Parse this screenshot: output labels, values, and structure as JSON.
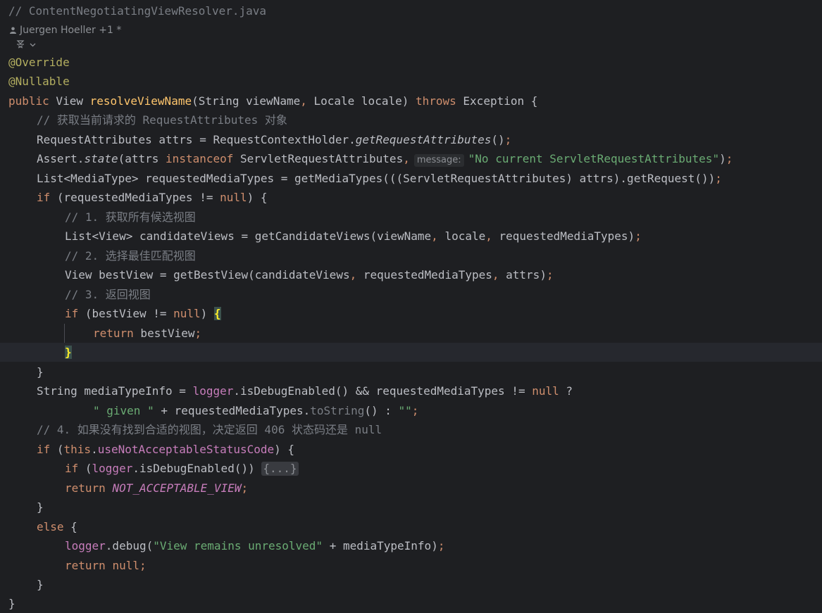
{
  "file_comment": "// ContentNegotiatingViewResolver.java",
  "author": {
    "icon": "user-icon",
    "text": "Juergen Hoeller +1 *"
  },
  "ai_actions": {
    "icon": "ai-assistant-icon",
    "chevron": "chevron-down-icon"
  },
  "code": {
    "l_override": "@Override",
    "l_nullable": "@Nullable",
    "l_sig": {
      "kw_public": "public",
      "type_view": " View ",
      "method": "resolveViewName",
      "params_a": "(String viewName",
      "comma": ",",
      "params_b": " Locale locale) ",
      "kw_throws": "throws",
      "tail": " Exception {"
    },
    "l_c1": "// 获取当前请求的 RequestAttributes 对象",
    "l_attrs": {
      "a": "RequestAttributes attrs = RequestContextHolder.",
      "m": "getRequestAttributes",
      "b": "()",
      "semi": ";"
    },
    "l_assert": {
      "a": "Assert.",
      "m": "state",
      "b": "(attrs ",
      "kw": "instanceof",
      "c": " ServletRequestAttributes",
      "comma": ",",
      "hint": "message:",
      "s": "\"No current ServletRequestAttributes\"",
      "d": ")",
      "semi": ";"
    },
    "l_mt": {
      "a": "List<MediaType> requestedMediaTypes = getMediaTypes(((ServletRequestAttributes) attrs).getRequest())",
      "semi": ";"
    },
    "l_if1": {
      "kw": "if",
      "a": " (requestedMediaTypes != ",
      "nul": "null",
      "b": ") {"
    },
    "l_c2": "// 1. 获取所有候选视图",
    "l_cand": {
      "a": "List<View> candidateViews = getCandidateViews(viewName",
      "c1": ",",
      "b": " locale",
      "c2": ",",
      "c": " requestedMediaTypes)",
      "semi": ";"
    },
    "l_c3": "// 2. 选择最佳匹配视图",
    "l_best": {
      "a": "View bestView = getBestView(candidateViews",
      "c1": ",",
      "b": " requestedMediaTypes",
      "c2": ",",
      "c": " attrs)",
      "semi": ";"
    },
    "l_c4": "// 3. 返回视图",
    "l_if2": {
      "kw": "if",
      "a": " (bestView != ",
      "nul": "null",
      "b": ") ",
      "brace": "{"
    },
    "l_ret1": {
      "kw": "return",
      "a": " bestView",
      "semi": ";"
    },
    "l_close_match": "}",
    "l_close1": "}",
    "l_info1": {
      "a": "String mediaTypeInfo = ",
      "f": "logger",
      "b": ".isDebugEnabled() && requestedMediaTypes != ",
      "nul": "null",
      "c": " ?"
    },
    "l_info2": {
      "s1": "\" given \"",
      "a": " + requestedMediaTypes.",
      "m": "toString",
      "b": "() : ",
      "s2": "\"\"",
      "semi": ";"
    },
    "l_c5": "// 4. 如果没有找到合适的视图，决定返回 406 状态码还是 null",
    "l_if3": {
      "kw": "if",
      "a": " (",
      "kw_this": "this",
      "dot": ".",
      "f": "useNotAcceptableStatusCode",
      "b": ") {"
    },
    "l_if4": {
      "kw": "if",
      "a": " (",
      "f": "logger",
      "b": ".isDebugEnabled()) ",
      "fold": "{...}"
    },
    "l_ret2": {
      "kw": "return",
      "a": " ",
      "const": "NOT_ACCEPTABLE_VIEW",
      "semi": ";"
    },
    "l_close2": "}",
    "l_else": {
      "kw": "else",
      "a": " {"
    },
    "l_debug": {
      "f": "logger",
      "a": ".debug(",
      "s": "\"View remains unresolved\"",
      "b": " + mediaTypeInfo)",
      "semi": ";"
    },
    "l_ret3": {
      "kw": "return",
      "a": " ",
      "nul": "null",
      "semi": ";"
    },
    "l_close3": "}",
    "l_close4": "}"
  },
  "colors": {
    "background": "#1e1f22",
    "comment": "#7a7e85",
    "annotation": "#b3ae60",
    "keyword": "#cf8e6d",
    "method_decl": "#ffc66d",
    "string": "#6aab73",
    "field": "#c77dbb",
    "text": "#bcbec4",
    "brace_match": "#ffef28"
  }
}
